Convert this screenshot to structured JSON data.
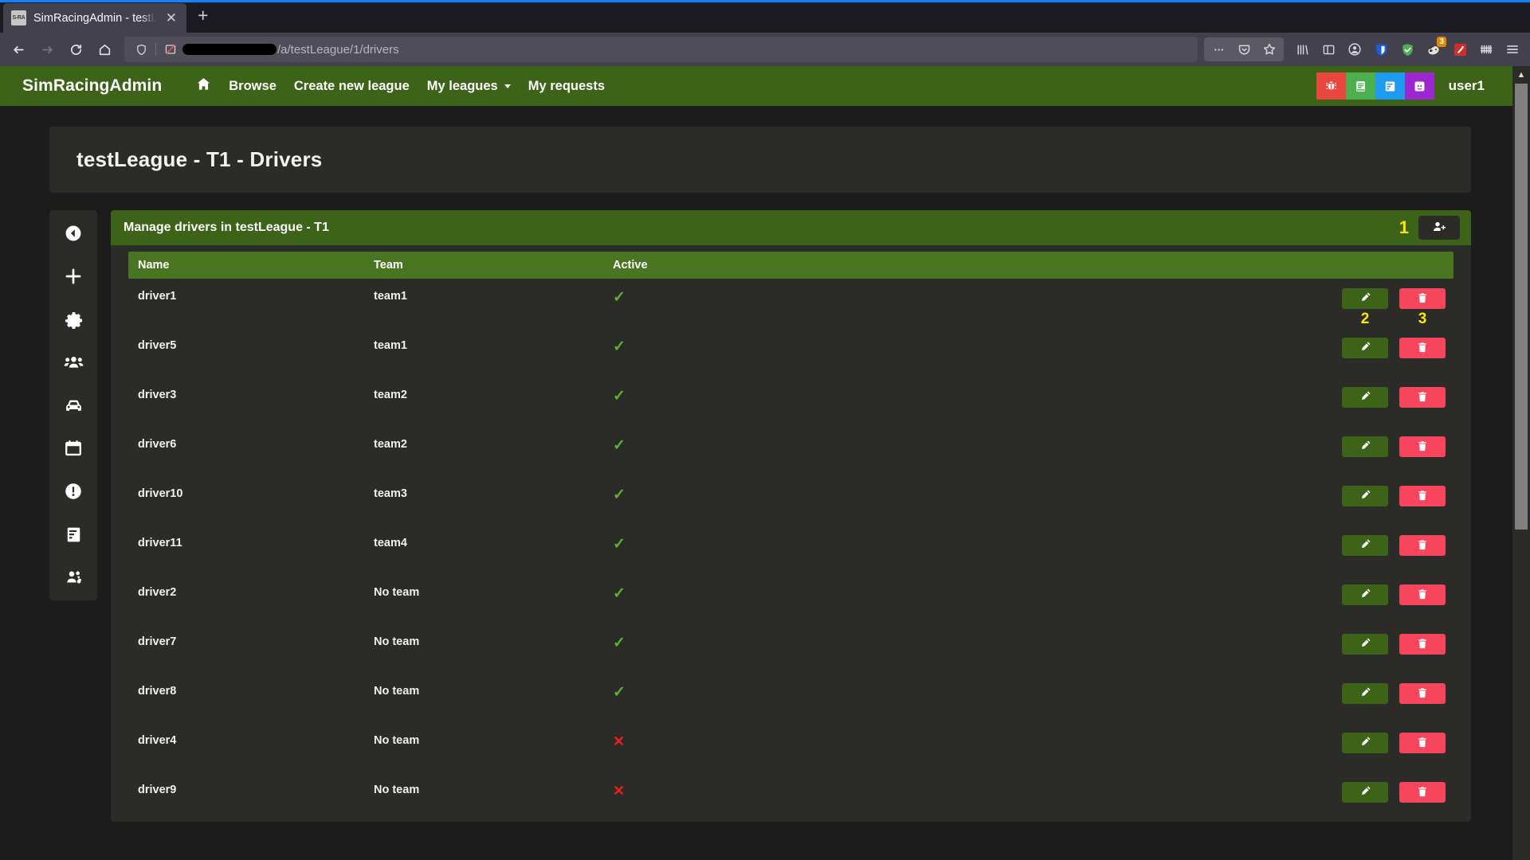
{
  "browser": {
    "tab": {
      "favicon_text": "S-RA",
      "title": "SimRacingAdmin - testLeague -",
      "close_label": "✕"
    },
    "newtab_label": "+",
    "url": {
      "path_text": "/a/testLeague/1/drivers"
    },
    "extensions": [
      "overflow-menu-icon",
      "pocket-icon",
      "bookmark-star-icon",
      "library-icon",
      "sidebar-icon",
      "account-icon",
      "bitwarden-icon",
      "adblock-shield-icon",
      "privacy-badger-icon",
      "wappalyzer-icon",
      "toolbar-grid-icon",
      "hamburger-menu-icon"
    ],
    "badge_count": "3"
  },
  "appnav": {
    "brand": "SimRacingAdmin",
    "links": [
      {
        "label": "",
        "icon": "home-icon"
      },
      {
        "label": "Browse",
        "icon": ""
      },
      {
        "label": "Create new league",
        "icon": ""
      },
      {
        "label": "My leagues",
        "icon": "",
        "caret": true
      },
      {
        "label": "My requests",
        "icon": ""
      }
    ],
    "actions": [
      {
        "name": "report-bug-button",
        "icon": "bug-icon",
        "color": "#e8463f"
      },
      {
        "name": "documentation-button",
        "icon": "book-icon",
        "color": "#4caf50"
      },
      {
        "name": "changelog-button",
        "icon": "list-icon",
        "color": "#1f9bf0"
      },
      {
        "name": "discord-button",
        "icon": "discord-icon",
        "color": "#9c27d0"
      }
    ],
    "user": "user1"
  },
  "page": {
    "title": "testLeague - T1 - Drivers"
  },
  "sidebar": {
    "items": [
      {
        "name": "back-button",
        "icon": "arrow-left-circle-icon"
      },
      {
        "name": "add-item-button",
        "icon": "plus-icon"
      },
      {
        "name": "settings-button",
        "icon": "gear-icon"
      },
      {
        "name": "drivers-button",
        "icon": "people-icon"
      },
      {
        "name": "cars-button",
        "icon": "car-icon"
      },
      {
        "name": "calendar-button",
        "icon": "calendar-icon"
      },
      {
        "name": "penalties-button",
        "icon": "exclamation-circle-icon"
      },
      {
        "name": "results-button",
        "icon": "file-text-icon"
      },
      {
        "name": "teams-button",
        "icon": "people-gear-icon"
      }
    ]
  },
  "card": {
    "header_title": "Manage drivers in testLeague - T1",
    "header_annotation": "1",
    "add_driver_icon": "person-add-icon",
    "columns": [
      "Name",
      "Team",
      "Active"
    ],
    "edit_annotation": "2",
    "delete_annotation": "3",
    "active_true_glyph": "✓",
    "active_false_glyph": "✕",
    "rows": [
      {
        "name": "driver1",
        "team": "team1",
        "active": true
      },
      {
        "name": "driver5",
        "team": "team1",
        "active": true
      },
      {
        "name": "driver3",
        "team": "team2",
        "active": true
      },
      {
        "name": "driver6",
        "team": "team2",
        "active": true
      },
      {
        "name": "driver10",
        "team": "team3",
        "active": true
      },
      {
        "name": "driver11",
        "team": "team4",
        "active": true
      },
      {
        "name": "driver2",
        "team": "No team",
        "active": true
      },
      {
        "name": "driver7",
        "team": "No team",
        "active": true
      },
      {
        "name": "driver8",
        "team": "No team",
        "active": true
      },
      {
        "name": "driver4",
        "team": "No team",
        "active": false
      },
      {
        "name": "driver9",
        "team": "No team",
        "active": false
      }
    ]
  },
  "colors": {
    "brand_green": "#3c6317",
    "table_head_green": "#4a7520",
    "annotation_yellow": "#ffe400",
    "delete_red": "#f7455d",
    "tick_green": "#5cb531",
    "cross_red": "#f0201c",
    "panel_dark": "#2b2b28",
    "page_dark": "#1c1c1c"
  }
}
